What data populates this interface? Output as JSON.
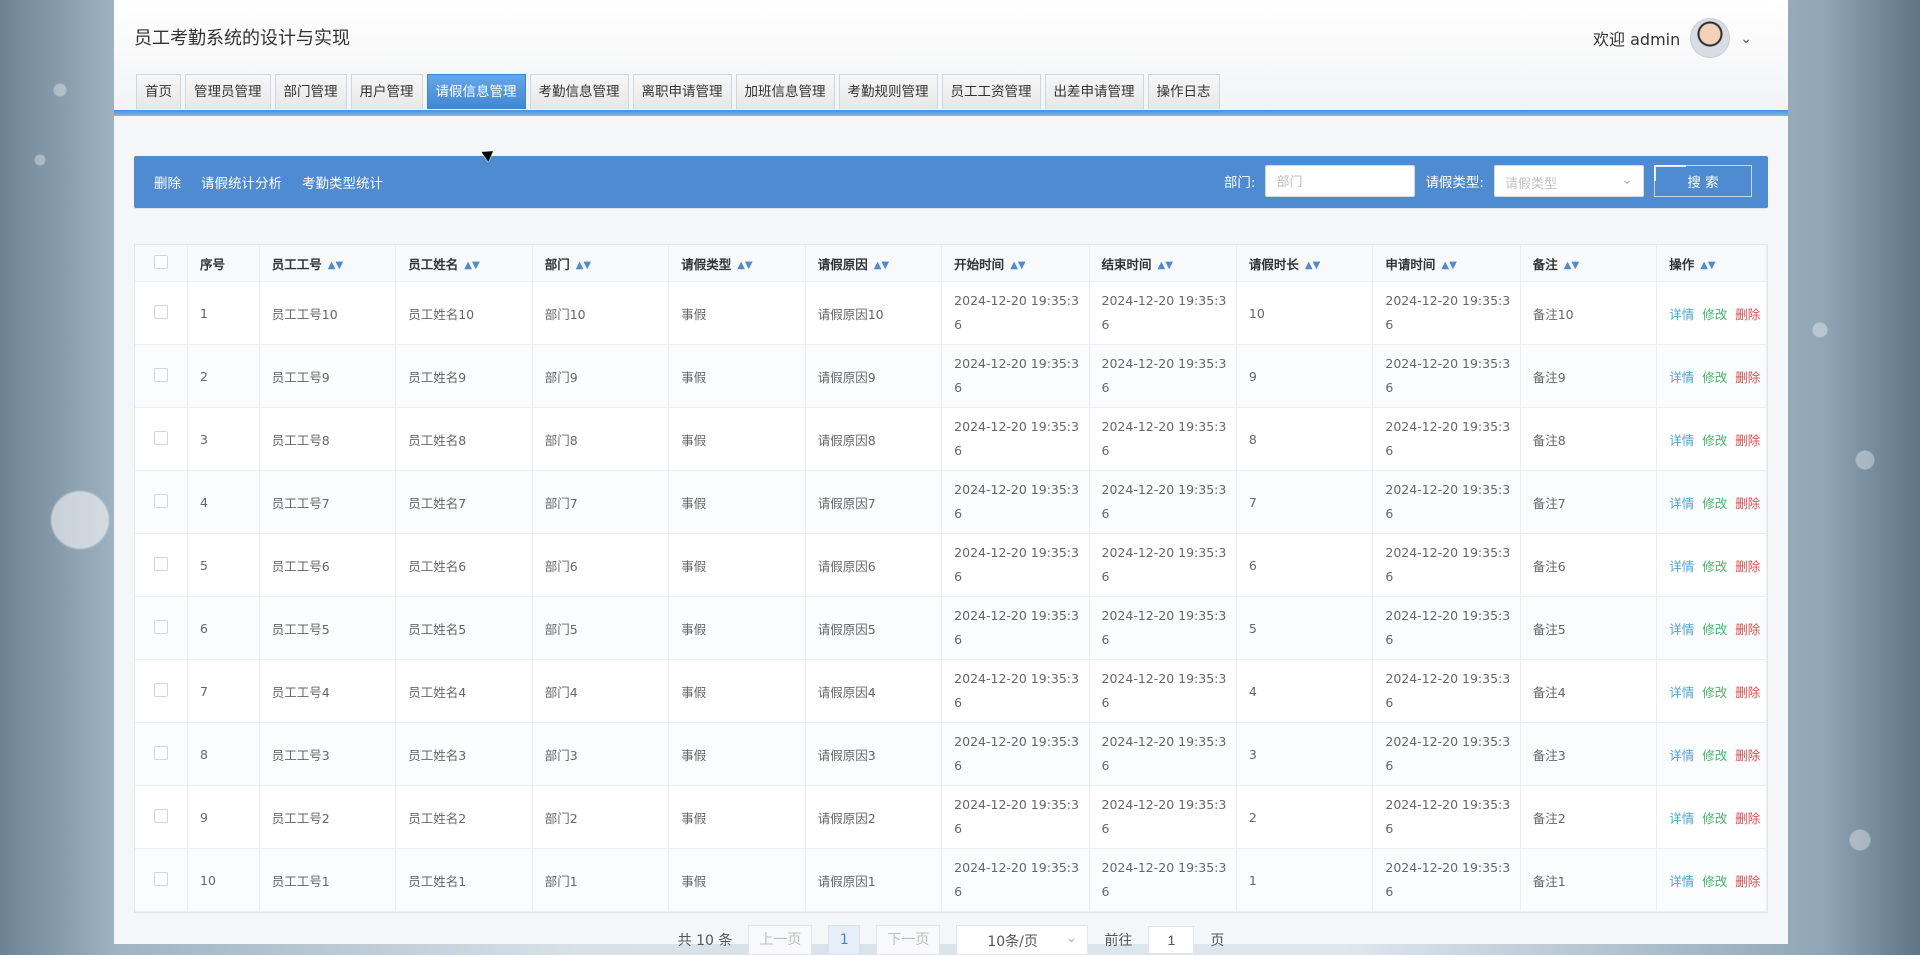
{
  "app": {
    "title": "员工考勤系统的设计与实现",
    "welcome_text": "欢迎 admin"
  },
  "nav": {
    "items": [
      {
        "label": "首页",
        "active": false
      },
      {
        "label": "管理员管理",
        "active": false
      },
      {
        "label": "部门管理",
        "active": false
      },
      {
        "label": "用户管理",
        "active": false
      },
      {
        "label": "请假信息管理",
        "active": true
      },
      {
        "label": "考勤信息管理",
        "active": false
      },
      {
        "label": "离职申请管理",
        "active": false
      },
      {
        "label": "加班信息管理",
        "active": false
      },
      {
        "label": "考勤规则管理",
        "active": false
      },
      {
        "label": "员工工资管理",
        "active": false
      },
      {
        "label": "出差申请管理",
        "active": false
      },
      {
        "label": "操作日志",
        "active": false
      }
    ]
  },
  "toolbar": {
    "links": [
      "删除",
      "请假统计分析",
      "考勤类型统计"
    ],
    "department_label": "部门:",
    "department_placeholder": "部门",
    "leave_type_label": "请假类型:",
    "leave_type_placeholder": "请假类型",
    "search_label": "搜 索"
  },
  "table": {
    "columns": [
      "序号",
      "员工工号",
      "员工姓名",
      "部门",
      "请假类型",
      "请假原因",
      "开始时间",
      "结束时间",
      "请假时长",
      "申请时间",
      "备注",
      "操作"
    ],
    "rows": [
      {
        "no": "1",
        "emp_no": "员工工号10",
        "name": "员工姓名10",
        "dept": "部门10",
        "type": "事假",
        "reason": "请假原因10",
        "start": "2024-12-20 19:35:3",
        "start2": "6",
        "end": "2024-12-20 19:35:3",
        "end2": "6",
        "duration": "10",
        "apply": "2024-12-20 19:35:3",
        "apply2": "6",
        "remark": "备注10"
      },
      {
        "no": "2",
        "emp_no": "员工工号9",
        "name": "员工姓名9",
        "dept": "部门9",
        "type": "事假",
        "reason": "请假原因9",
        "start": "2024-12-20 19:35:3",
        "start2": "6",
        "end": "2024-12-20 19:35:3",
        "end2": "6",
        "duration": "9",
        "apply": "2024-12-20 19:35:3",
        "apply2": "6",
        "remark": "备注9"
      },
      {
        "no": "3",
        "emp_no": "员工工号8",
        "name": "员工姓名8",
        "dept": "部门8",
        "type": "事假",
        "reason": "请假原因8",
        "start": "2024-12-20 19:35:3",
        "start2": "6",
        "end": "2024-12-20 19:35:3",
        "end2": "6",
        "duration": "8",
        "apply": "2024-12-20 19:35:3",
        "apply2": "6",
        "remark": "备注8"
      },
      {
        "no": "4",
        "emp_no": "员工工号7",
        "name": "员工姓名7",
        "dept": "部门7",
        "type": "事假",
        "reason": "请假原因7",
        "start": "2024-12-20 19:35:3",
        "start2": "6",
        "end": "2024-12-20 19:35:3",
        "end2": "6",
        "duration": "7",
        "apply": "2024-12-20 19:35:3",
        "apply2": "6",
        "remark": "备注7"
      },
      {
        "no": "5",
        "emp_no": "员工工号6",
        "name": "员工姓名6",
        "dept": "部门6",
        "type": "事假",
        "reason": "请假原因6",
        "start": "2024-12-20 19:35:3",
        "start2": "6",
        "end": "2024-12-20 19:35:3",
        "end2": "6",
        "duration": "6",
        "apply": "2024-12-20 19:35:3",
        "apply2": "6",
        "remark": "备注6"
      },
      {
        "no": "6",
        "emp_no": "员工工号5",
        "name": "员工姓名5",
        "dept": "部门5",
        "type": "事假",
        "reason": "请假原因5",
        "start": "2024-12-20 19:35:3",
        "start2": "6",
        "end": "2024-12-20 19:35:3",
        "end2": "6",
        "duration": "5",
        "apply": "2024-12-20 19:35:3",
        "apply2": "6",
        "remark": "备注5"
      },
      {
        "no": "7",
        "emp_no": "员工工号4",
        "name": "员工姓名4",
        "dept": "部门4",
        "type": "事假",
        "reason": "请假原因4",
        "start": "2024-12-20 19:35:3",
        "start2": "6",
        "end": "2024-12-20 19:35:3",
        "end2": "6",
        "duration": "4",
        "apply": "2024-12-20 19:35:3",
        "apply2": "6",
        "remark": "备注4"
      },
      {
        "no": "8",
        "emp_no": "员工工号3",
        "name": "员工姓名3",
        "dept": "部门3",
        "type": "事假",
        "reason": "请假原因3",
        "start": "2024-12-20 19:35:3",
        "start2": "6",
        "end": "2024-12-20 19:35:3",
        "end2": "6",
        "duration": "3",
        "apply": "2024-12-20 19:35:3",
        "apply2": "6",
        "remark": "备注3"
      },
      {
        "no": "9",
        "emp_no": "员工工号2",
        "name": "员工姓名2",
        "dept": "部门2",
        "type": "事假",
        "reason": "请假原因2",
        "start": "2024-12-20 19:35:3",
        "start2": "6",
        "end": "2024-12-20 19:35:3",
        "end2": "6",
        "duration": "2",
        "apply": "2024-12-20 19:35:3",
        "apply2": "6",
        "remark": "备注2"
      },
      {
        "no": "10",
        "emp_no": "员工工号1",
        "name": "员工姓名1",
        "dept": "部门1",
        "type": "事假",
        "reason": "请假原因1",
        "start": "2024-12-20 19:35:3",
        "start2": "6",
        "end": "2024-12-20 19:35:3",
        "end2": "6",
        "duration": "1",
        "apply": "2024-12-20 19:35:3",
        "apply2": "6",
        "remark": "备注1"
      }
    ],
    "actions": {
      "detail": "详情",
      "edit": "修改",
      "delete": "删除"
    },
    "sort_icon": "sort-icon"
  },
  "pagination": {
    "total_text": "共 10 条",
    "prev": "上一页",
    "current_page": "1",
    "next": "下一页",
    "page_size": "10条/页",
    "goto_label": "前往",
    "goto_value": "1",
    "page_suffix": "页"
  },
  "colors": {
    "accent": "#4f8bd1",
    "nav_active": "#4f8bd1",
    "detail": "#4aa3d8",
    "edit": "#47b36b",
    "delete": "#e04b4b"
  }
}
